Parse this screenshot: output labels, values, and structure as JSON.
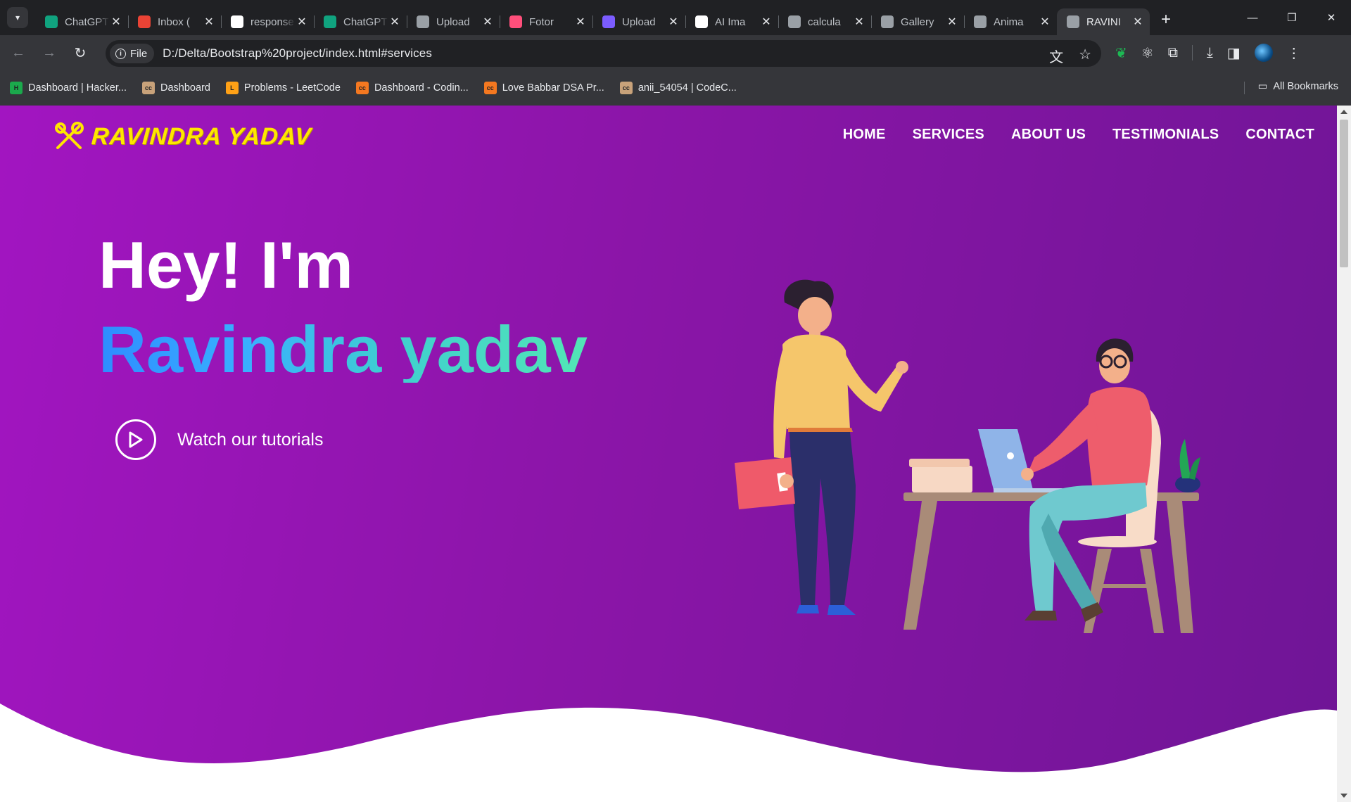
{
  "browser": {
    "tabs": [
      {
        "title": "ChatGPT",
        "favicon": "chatgpt-icon",
        "color": "#10a37f"
      },
      {
        "title": "Inbox (",
        "favicon": "gmail-icon",
        "color": "#ea4335"
      },
      {
        "title": "response",
        "favicon": "github-icon",
        "color": "#ffffff"
      },
      {
        "title": "ChatGPT",
        "favicon": "chatgpt-icon",
        "color": "#10a37f"
      },
      {
        "title": "Upload",
        "favicon": "upload-icon",
        "color": "#9aa0a6"
      },
      {
        "title": "Fotor",
        "favicon": "fotor-icon",
        "color": "#ff4f7b"
      },
      {
        "title": "Upload",
        "favicon": "fotor-icon",
        "color": "#7b5cff"
      },
      {
        "title": "AI Ima",
        "favicon": "ai-icon",
        "color": "#ffffff"
      },
      {
        "title": "calcula",
        "favicon": "globe-icon",
        "color": "#9aa0a6"
      },
      {
        "title": "Gallery",
        "favicon": "globe-icon",
        "color": "#9aa0a6"
      },
      {
        "title": "Anima",
        "favicon": "globe-icon",
        "color": "#9aa0a6"
      },
      {
        "title": "RAVINI",
        "favicon": "globe-icon",
        "color": "#9aa0a6",
        "active": true
      }
    ],
    "address": {
      "scheme_label": "File",
      "url": "D:/Delta/Bootstrap%20project/index.html#services"
    },
    "bookmarks": [
      {
        "label": "Dashboard | Hacker...",
        "icon": "hackerrank-icon",
        "color": "#1ba94c",
        "fav": "H"
      },
      {
        "label": "Dashboard",
        "icon": "codechef-icon",
        "color": "#c8a27a",
        "fav": "cc"
      },
      {
        "label": "Problems - LeetCode",
        "icon": "leetcode-icon",
        "color": "#ffa116",
        "fav": "L"
      },
      {
        "label": "Dashboard - Codin...",
        "icon": "codingninjas-icon",
        "color": "#f47820",
        "fav": "cc"
      },
      {
        "label": "Love Babbar DSA Pr...",
        "icon": "codingninjas-icon",
        "color": "#f47820",
        "fav": "cc"
      },
      {
        "label": "anii_54054 | CodeC...",
        "icon": "codechef-icon",
        "color": "#c8a27a",
        "fav": "cc"
      }
    ],
    "all_bookmarks_label": "All Bookmarks"
  },
  "site": {
    "logo_text": "RAVINDRA YADAV",
    "nav": [
      "HOME",
      "SERVICES",
      "ABOUT US",
      "TESTIMONIALS",
      "CONTACT"
    ],
    "hero_line1": "Hey! I'm",
    "hero_line2": "Ravindra yadav",
    "cta_label": "Watch our tutorials",
    "colors": {
      "gradient_start": "#a215c1",
      "gradient_end": "#6f1596",
      "logo": "#ffe600",
      "name_gradient": [
        "#2e8cff",
        "#52e6b5"
      ]
    }
  }
}
